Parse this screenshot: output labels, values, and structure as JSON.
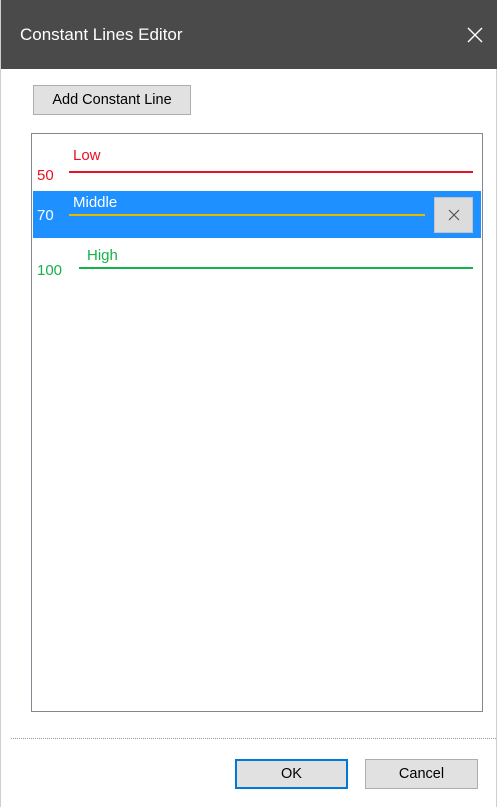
{
  "window": {
    "title": "Constant Lines Editor"
  },
  "toolbar": {
    "add_label": "Add Constant Line"
  },
  "constant_lines": [
    {
      "value": "50",
      "label": "Low",
      "color": "#e81123",
      "selected": false
    },
    {
      "value": "70",
      "label": "Middle",
      "color": "#e6b800",
      "selected": true
    },
    {
      "value": "100",
      "label": "High",
      "color": "#16b14a",
      "selected": false
    }
  ],
  "selection": {
    "highlight_color": "#1e90ff",
    "remove_icon": "close-icon"
  },
  "footer": {
    "ok_label": "OK",
    "cancel_label": "Cancel"
  },
  "colors": {
    "titlebar": "#4a4a4a",
    "accent": "#0078d7"
  }
}
